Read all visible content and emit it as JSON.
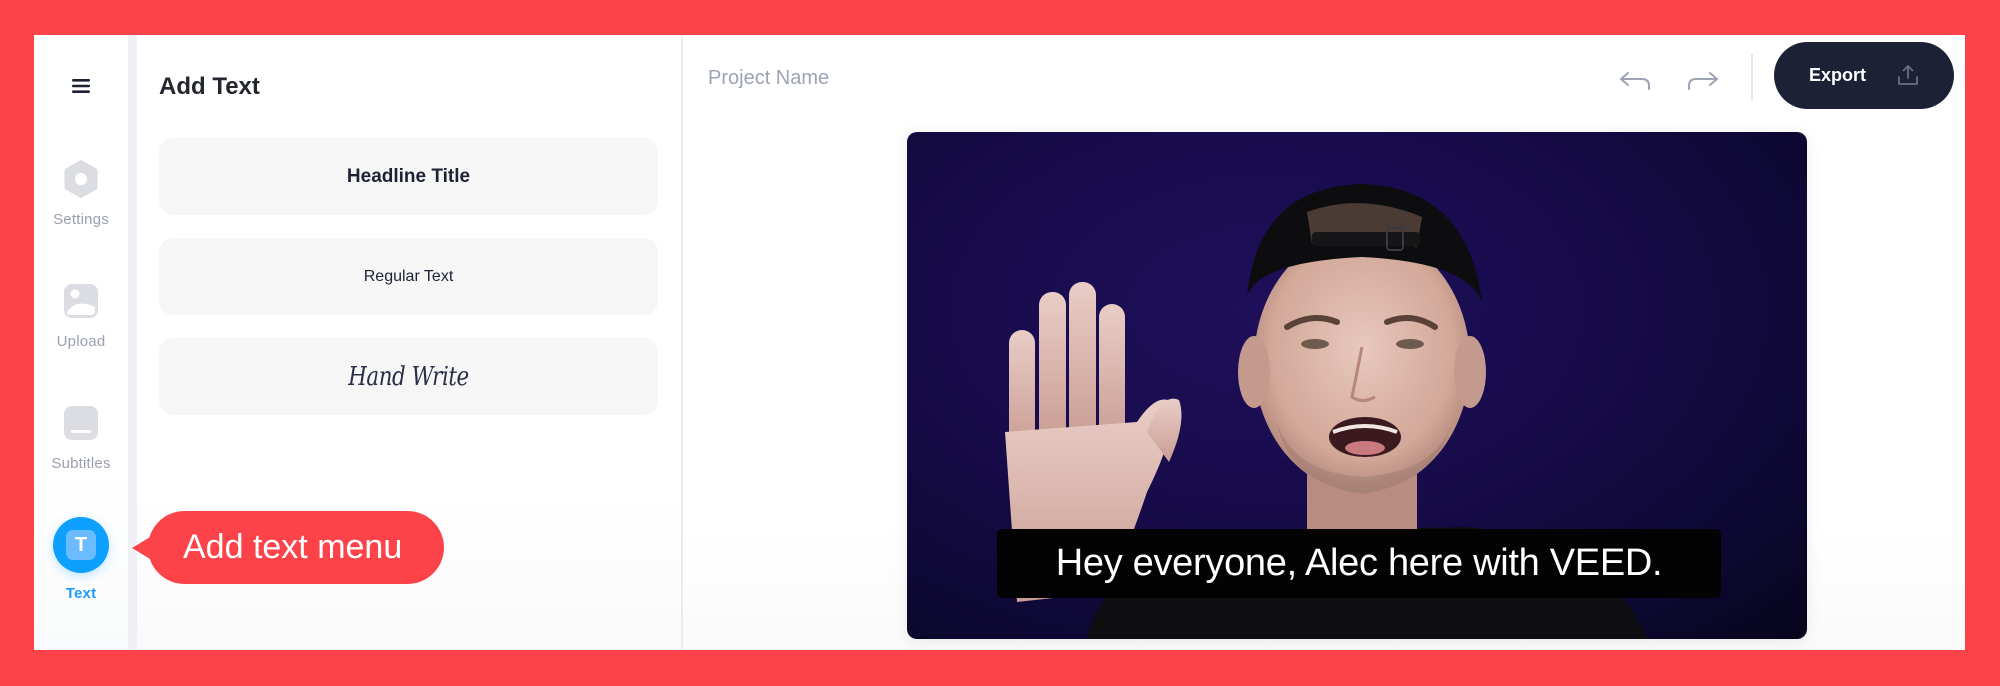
{
  "colors": {
    "frame_background": "#fc434a",
    "accent_blue": "#0ea0ff",
    "export_button": "#1d2136",
    "callout": "#fc434a"
  },
  "rail": {
    "menu_icon": "hamburger-menu-icon",
    "items": [
      {
        "label": "Settings",
        "icon": "settings-icon",
        "active": false
      },
      {
        "label": "Upload",
        "icon": "image-upload-icon",
        "active": false
      },
      {
        "label": "Subtitles",
        "icon": "subtitles-icon",
        "active": false
      },
      {
        "label": "Text",
        "icon": "text-icon",
        "active": true,
        "icon_glyph": "T"
      }
    ]
  },
  "panel": {
    "title": "Add Text",
    "presets": [
      {
        "label": "Headline Title",
        "style": "headline"
      },
      {
        "label": "Regular Text",
        "style": "regular"
      },
      {
        "label": "Hand Write",
        "style": "handwriting"
      }
    ]
  },
  "callout": {
    "text": "Add text menu"
  },
  "toolbar": {
    "project_name_placeholder": "Project Name",
    "undo_icon": "undo-icon",
    "redo_icon": "redo-icon",
    "export_label": "Export",
    "export_icon": "upload-icon"
  },
  "video": {
    "subtitle": "Hey everyone, Alec here with VEED."
  }
}
